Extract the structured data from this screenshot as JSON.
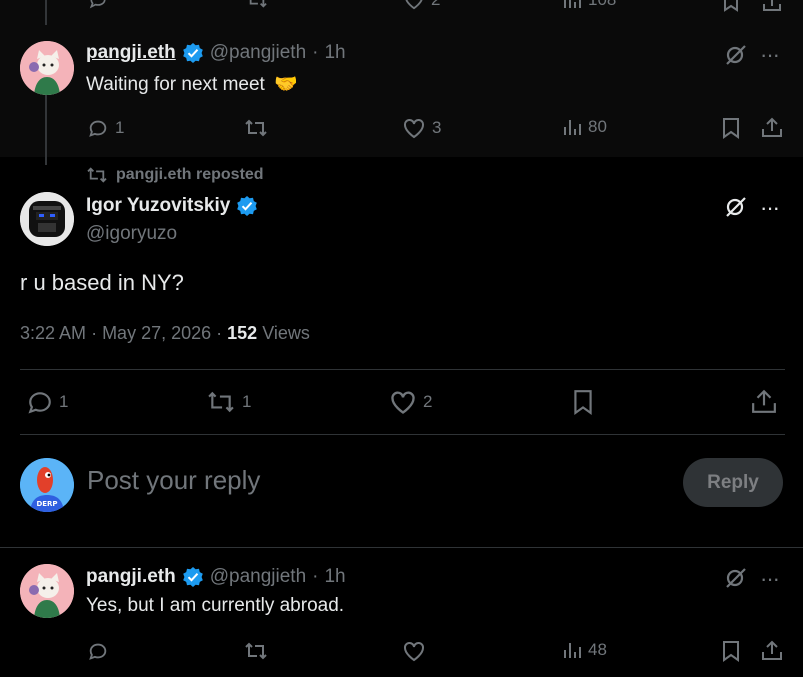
{
  "top_partial": {
    "like_count": "2",
    "views_count": "108"
  },
  "tweet1": {
    "name": "pangji.eth",
    "handle": "@pangjieth",
    "time": "1h",
    "text": "Waiting for next meet",
    "emoji": "🫱🏻‍🫲🏼",
    "reply_count": "1",
    "retweet_count": "",
    "like_count": "3",
    "views_count": "80"
  },
  "repost_banner": {
    "text": "pangji.eth reposted"
  },
  "main_tweet": {
    "name": "Igor Yuzovitskiy",
    "handle": "@igoryuzo",
    "text": "r u based in NY?",
    "time": "3:22 AM",
    "date": "May 27, 2026",
    "views_number": "152",
    "views_label": "Views",
    "reply_count": "1",
    "retweet_count": "1",
    "like_count": "2"
  },
  "composer": {
    "placeholder": "Post your reply",
    "button_label": "Reply",
    "avatar_badge": "DERP"
  },
  "tweet2": {
    "name": "pangji.eth",
    "handle": "@pangjieth",
    "time": "1h",
    "text": "Yes, but I am currently abroad.",
    "views_count": "48"
  },
  "colors": {
    "background": "#000000",
    "highlight": "#0a0a0a",
    "text": "#e7e9ea",
    "muted": "#71767b",
    "verified": "#1d9bf0",
    "divider": "#2f3336"
  }
}
